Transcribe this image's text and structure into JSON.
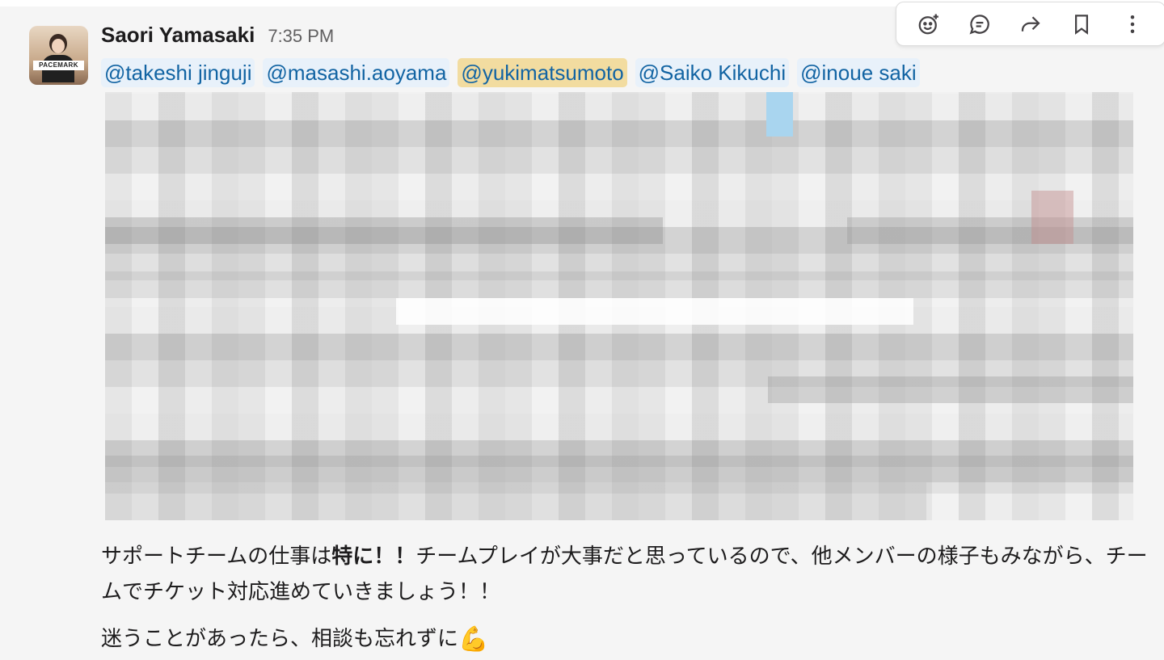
{
  "author": {
    "name": "Saori Yamasaki",
    "time": "7:35 PM",
    "avatar_text": "PACEMARK"
  },
  "mentions": [
    "@takeshi jinguji",
    "@masashi.aoyama",
    "@yukimatsumoto",
    "@Saiko Kikuchi",
    "@inoue saki"
  ],
  "body": {
    "p1_before": "サポートチームの仕事は",
    "p1_bold": "特に！！",
    "p1_after": "チームプレイが大事だと思っているので、他メンバーの様子もみながら、チームでチケット対応進めていきましょう！！",
    "p2": "迷うことがあったら、相談も忘れずに",
    "p2_emoji": "💪"
  },
  "toolbar": {
    "icons": [
      "add-reaction-icon",
      "reply-in-thread-icon",
      "share-message-icon",
      "save-bookmark-icon",
      "more-actions-icon"
    ]
  },
  "colors": {
    "mention_text": "#1264a3",
    "mention_bg": "#e8f1fa",
    "self_mention_bg": "#f2dca0",
    "message_bg": "#f5f5f5"
  }
}
